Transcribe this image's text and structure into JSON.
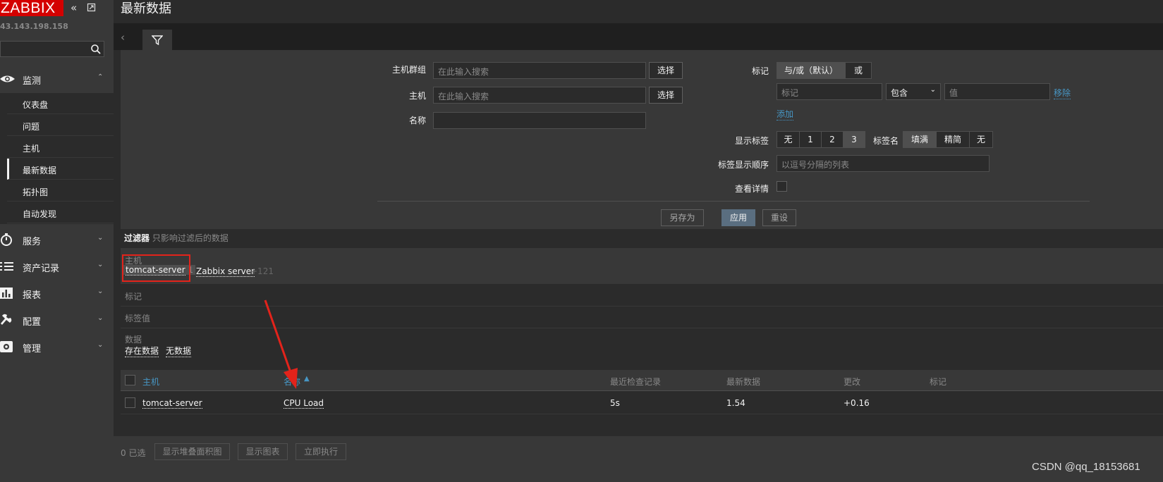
{
  "sidebar": {
    "logo": "ZABBIX",
    "collapse_icon": "double-chevron-left-icon",
    "kiosk_icon": "kiosk-mode-icon",
    "server_name": "43.143.198.158",
    "search_icon": "search-icon",
    "sections": [
      {
        "label": "监测",
        "icon": "eye-icon",
        "expanded": true
      },
      {
        "label": "服务",
        "icon": "stopwatch-icon"
      },
      {
        "label": "资产记录",
        "icon": "list-icon"
      },
      {
        "label": "报表",
        "icon": "bar-chart-icon"
      },
      {
        "label": "配置",
        "icon": "wrench-icon"
      },
      {
        "label": "管理",
        "icon": "gear-icon"
      }
    ],
    "monitoring_items": [
      {
        "label": "仪表盘"
      },
      {
        "label": "问题"
      },
      {
        "label": "主机"
      },
      {
        "label": "最新数据",
        "active": true
      },
      {
        "label": "拓扑图"
      },
      {
        "label": "自动发现"
      }
    ]
  },
  "header": {
    "title": "最新数据"
  },
  "filter": {
    "host_group_label": "主机群组",
    "host_group_placeholder": "在此输入搜索",
    "select_label": "选择",
    "host_label": "主机",
    "host_placeholder": "在此输入搜索",
    "name_label": "名称",
    "name_value": "",
    "tags_label": "标记",
    "tags_mode": [
      "与/或（默认）",
      "或"
    ],
    "tag_placeholder": "标记",
    "tag_op": "包含",
    "value_placeholder": "值",
    "remove_label": "移除",
    "add_label": "添加",
    "show_tags_label": "显示标签",
    "show_tags_options": [
      "无",
      "1",
      "2",
      "3"
    ],
    "tag_name_label": "标签名",
    "tag_name_options": [
      "填满",
      "精简",
      "无"
    ],
    "tag_order_label": "标签显示顺序",
    "tag_order_placeholder": "以逗号分隔的列表",
    "details_label": "查看详情",
    "save_as_label": "另存为",
    "apply_label": "应用",
    "reset_label": "重设"
  },
  "facets": {
    "caption_bold": "过滤器",
    "caption_rest": "只影响过滤后的数据",
    "host_label": "主机",
    "host_values": [
      {
        "name": "tomcat-server",
        "count": "1"
      },
      {
        "name": "Zabbix server",
        "count": ""
      }
    ],
    "host_more": "+121",
    "tags_label": "标记",
    "tag_values_label": "标签值",
    "data_label": "数据",
    "data_values": [
      "存在数据",
      "无数据"
    ]
  },
  "table": {
    "headers": {
      "host": "主机",
      "name": "名称",
      "last_check": "最近检查记录",
      "last_value": "最新数据",
      "change": "更改",
      "tags": "标记"
    },
    "rows": [
      {
        "host": "tomcat-server",
        "name": "CPU Load",
        "last_check": "5s",
        "last_value": "1.54",
        "change": "+0.16",
        "tags": ""
      }
    ]
  },
  "footer": {
    "selected": "0 已选",
    "actions": [
      "显示堆叠面积图",
      "显示图表",
      "立即执行"
    ]
  },
  "watermark": "CSDN @qq_18153681",
  "colors": {
    "accent": "#4796c4",
    "brand": "#d40000",
    "annotation": "#e3231b"
  }
}
